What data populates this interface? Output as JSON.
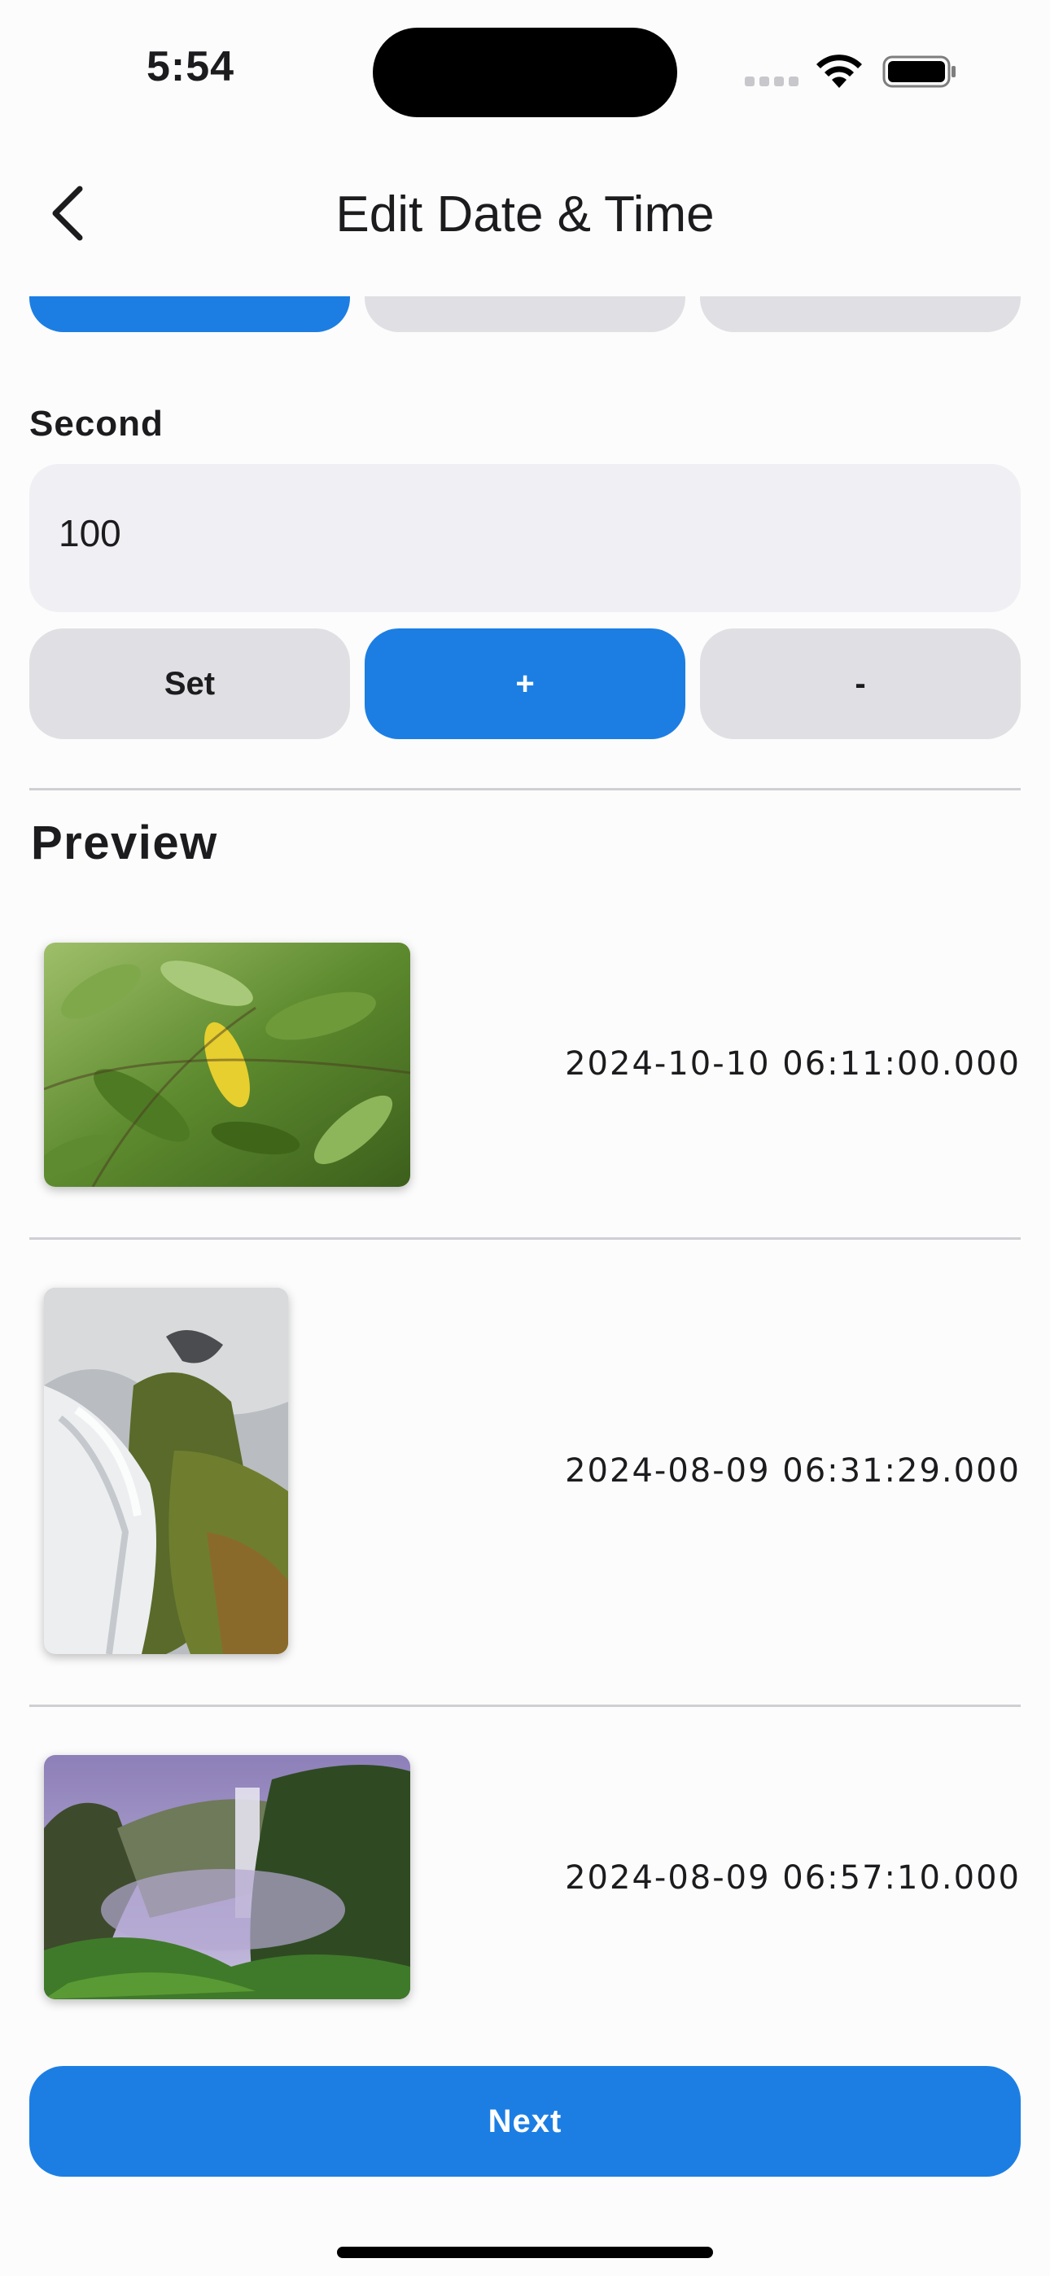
{
  "status_bar": {
    "time": "5:54"
  },
  "nav": {
    "title": "Edit Date & Time"
  },
  "second_section": {
    "label": "Second",
    "input_value": "100",
    "buttons": {
      "set": "Set",
      "plus": "+",
      "minus": "-"
    }
  },
  "preview": {
    "title": "Preview",
    "items": [
      {
        "image": "green-leaves-yellow-leaf-photo",
        "date": "2024-10-10 06:11:00.000"
      },
      {
        "image": "waterfall-rocks-moss-photo",
        "date": "2024-08-09 06:31:29.000"
      },
      {
        "image": "misty-waterfall-canyon-photo",
        "date": "2024-08-09 06:57:10.000"
      }
    ]
  },
  "footer": {
    "next_label": "Next"
  },
  "colors": {
    "accent": "#1c7ee3",
    "button_gray": "#e0e0e4",
    "input_bg": "#f0f0f4"
  }
}
